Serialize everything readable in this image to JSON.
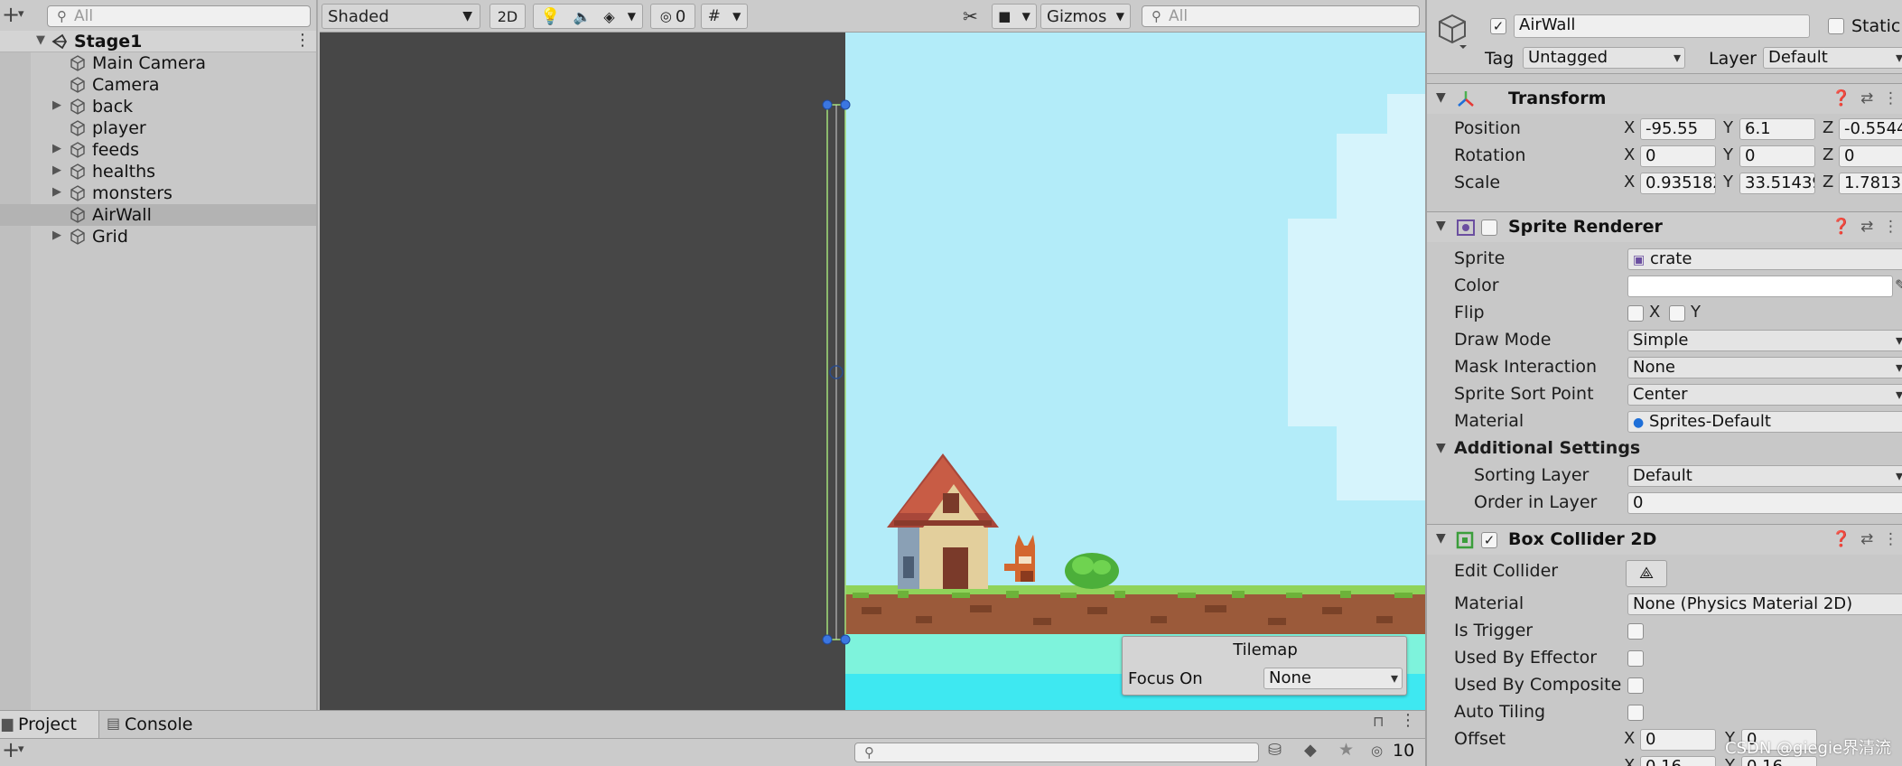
{
  "hierarchy": {
    "search_placeholder": "All",
    "scene_name": "Stage1",
    "items": [
      {
        "label": "Main Camera",
        "expandable": false
      },
      {
        "label": "Camera",
        "expandable": false
      },
      {
        "label": "back",
        "expandable": true
      },
      {
        "label": "player",
        "expandable": false
      },
      {
        "label": "feeds",
        "expandable": true
      },
      {
        "label": "healths",
        "expandable": true
      },
      {
        "label": "monsters",
        "expandable": true
      },
      {
        "label": "AirWall",
        "expandable": false,
        "selected": true
      },
      {
        "label": "Grid",
        "expandable": true
      }
    ]
  },
  "scene_toolbar": {
    "shading_mode": "Shaded",
    "mode_2d": "2D",
    "hidden_count": "0",
    "gizmos": "Gizmos",
    "search_placeholder": "All"
  },
  "tilemap_overlay": {
    "title": "Tilemap",
    "focus_label": "Focus On",
    "focus_value": "None"
  },
  "bottom": {
    "tabs": [
      "Project",
      "Console"
    ],
    "hidden_count": "10"
  },
  "inspector": {
    "object_name": "AirWall",
    "static_label": "Static",
    "tag_label": "Tag",
    "tag_value": "Untagged",
    "layer_label": "Layer",
    "layer_value": "Default",
    "transform": {
      "title": "Transform",
      "position": {
        "label": "Position",
        "x": "-95.55",
        "y": "6.1",
        "z": "-0.5544"
      },
      "rotation": {
        "label": "Rotation",
        "x": "0",
        "y": "0",
        "z": "0"
      },
      "scale": {
        "label": "Scale",
        "x": "0.935182",
        "y": "33.51439",
        "z": "1.7813"
      }
    },
    "sprite_renderer": {
      "title": "Sprite Renderer",
      "sprite_label": "Sprite",
      "sprite_value": "crate",
      "color_label": "Color",
      "flip_label": "Flip",
      "flip_x": "X",
      "flip_y": "Y",
      "draw_mode_label": "Draw Mode",
      "draw_mode_value": "Simple",
      "mask_label": "Mask Interaction",
      "mask_value": "None",
      "sort_point_label": "Sprite Sort Point",
      "sort_point_value": "Center",
      "material_label": "Material",
      "material_value": "Sprites-Default",
      "additional_label": "Additional Settings",
      "sorting_layer_label": "Sorting Layer",
      "sorting_layer_value": "Default",
      "order_label": "Order in Layer",
      "order_value": "0"
    },
    "box_collider": {
      "title": "Box Collider 2D",
      "edit_label": "Edit Collider",
      "material_label": "Material",
      "material_value": "None (Physics Material 2D)",
      "trigger_label": "Is Trigger",
      "effector_label": "Used By Effector",
      "composite_label": "Used By Composite",
      "tiling_label": "Auto Tiling",
      "offset_label": "Offset",
      "offset_x": "0",
      "offset_y": "0",
      "size_x": "0.16",
      "size_y": "0.16"
    }
  },
  "watermark": "CSDN @giegie界清流",
  "colors": {
    "sky": "#b3ecf9",
    "dark_bg": "#474747",
    "grass": "#8fd35a",
    "dirt": "#9b5a3a",
    "water": "#7ef3dc",
    "selection": "#b3b3b3"
  }
}
